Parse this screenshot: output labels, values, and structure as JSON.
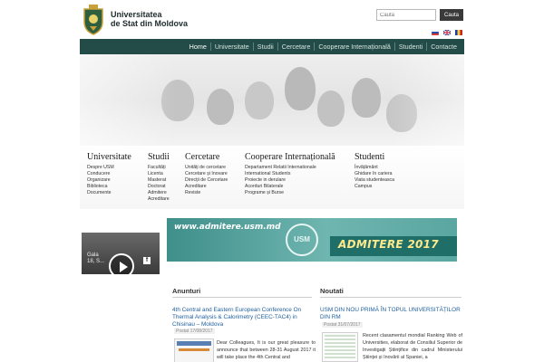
{
  "header": {
    "brand_line1": "Universitatea",
    "brand_line2": "de Stat din Moldova",
    "search": {
      "placeholder": "Cauta",
      "button_label": "Cauta"
    },
    "languages": [
      {
        "icon": "flag-ru-icon"
      },
      {
        "icon": "flag-en-icon"
      },
      {
        "icon": "flag-ro-icon"
      }
    ]
  },
  "nav": {
    "items": [
      "Home",
      "Universitate",
      "Studii",
      "Cercetare",
      "Cooperare Internațională",
      "Studenti",
      "Contacte"
    ],
    "active_index": 0
  },
  "menus": [
    {
      "title": "Universitate",
      "links": [
        "Despre USM",
        "Conducere",
        "Organizare",
        "Biblioteca",
        "Documente"
      ]
    },
    {
      "title": "Studii",
      "links": [
        "Facultăți",
        "Licenta",
        "Masterat",
        "Doctorat",
        "Admitere",
        "Acreditare"
      ]
    },
    {
      "title": "Cercetare",
      "links": [
        "Unități de cercetare",
        "Cercetare și Inovare",
        "Direcții de Cercetare",
        "Acreditare",
        "Reviste"
      ]
    },
    {
      "title": "Cooperare Internațională",
      "links": [
        "Departament Relatii Internationale",
        "International Students",
        "Proiecte in derulare",
        "Acorduri Bilaterale",
        "Programe și Burse"
      ]
    },
    {
      "title": "Studenti",
      "links": [
        "Învățământ",
        "Ghidare în cariera",
        "Viata studenteasca",
        "Campus"
      ]
    }
  ],
  "banner": {
    "url": "www.admitere.usm.md",
    "seal": "USM",
    "title": "ADMITERE 2017"
  },
  "video": {
    "caption_line1": "Gala",
    "caption_line2": "18, S..."
  },
  "anunturi": {
    "heading": "Anunturi",
    "item": {
      "title": "4th Central and Eastern European Conference On Thermal Analysis & Calorimetry (CEEC-TAC4) in Chisinau – Moldova",
      "date": "Postat 17/08/2017",
      "text": "Dear Colleagues, It is our great pleasure to announce that between 28-31 August 2017 it will take place the 4th Central and"
    }
  },
  "noutati": {
    "heading": "Noutati",
    "item": {
      "title": "USM DIN NOU PRIMĂ ÎN TOPUL UNIVERSITĂȚILOR DIN RM",
      "date": "Postat 31/07/2017",
      "text": "Recent clasamentul mondial Ranking Web of Universities, elaborat de Consiliul Superior de Investigații Științifice din cadrul Ministerului Științei și Inovării al Spaniei, a"
    }
  },
  "colors": {
    "nav_bg": "#234b47",
    "link": "#1f5f9e",
    "banner": "#4c9f99"
  }
}
